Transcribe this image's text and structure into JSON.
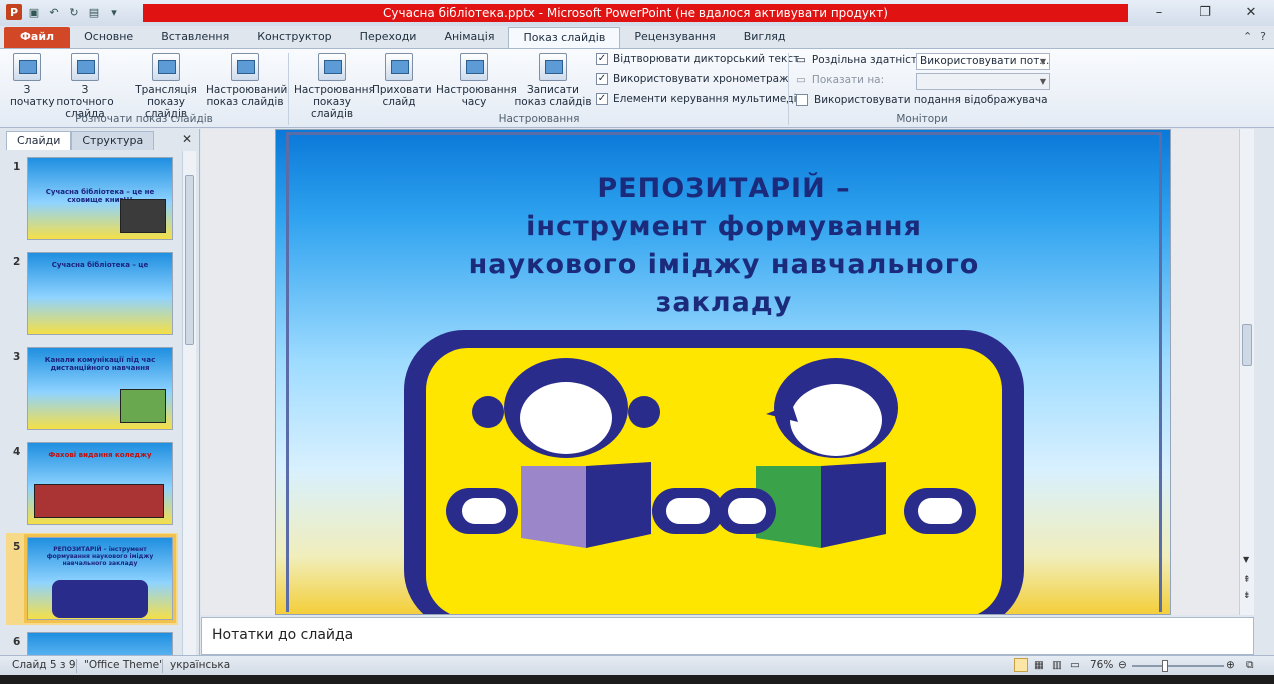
{
  "window": {
    "title": "Сучасна бібліотека.pptx - Microsoft PowerPoint (не вдалося активувати продукт)",
    "min": "–",
    "max": "❐",
    "close": "✕"
  },
  "tabs": [
    "Файл",
    "Основне",
    "Вставлення",
    "Конструктор",
    "Переходи",
    "Анімація",
    "Показ слайдів",
    "Рецензування",
    "Вигляд"
  ],
  "active_tab": "Показ слайдів",
  "ribbon": {
    "start_group": {
      "label": "Розпочати показ слайдів",
      "from_start": "З\nпочатку",
      "from_current": "З поточного\nслайда",
      "broadcast": "Трансляція\nпоказу слайдів",
      "custom": "Настроюваний\nпоказ слайдів"
    },
    "setup_group": {
      "label": "Настроювання",
      "setup": "Настроювання\nпоказу слайдів",
      "hide": "Приховати\nслайд",
      "rehearse": "Настроювання\nчасу",
      "record": "Записати\nпоказ слайдів",
      "checks": [
        {
          "label": "Відтворювати дикторський текст",
          "checked": true
        },
        {
          "label": "Використовувати хронометраж",
          "checked": true
        },
        {
          "label": "Елементи керування мультимедіа",
          "checked": true
        }
      ]
    },
    "monitors_group": {
      "label": "Монітори",
      "resolution_label": "Роздільна здатність:",
      "resolution_value": "Використовувати пот...",
      "show_on_label": "Показати на:",
      "show_on_value": "",
      "presenter_view_label": "Використовувати подання відображувача",
      "presenter_view_checked": false
    }
  },
  "left_pane": {
    "tab_slides": "Слайди",
    "tab_outline": "Структура",
    "close": "✕",
    "thumbs": [
      {
        "num": "1",
        "text": "Сучасна бібліотека – це не сховище книг!!!"
      },
      {
        "num": "2",
        "text": "Сучасна бібліотека – це"
      },
      {
        "num": "3",
        "text": "Канали комунікації під час дистанційного навчання"
      },
      {
        "num": "4",
        "text": "Фахові видання коледжу"
      },
      {
        "num": "5",
        "text": "РЕПОЗИТАРІЙ – інструмент формування наукового іміджу навчального закладу"
      },
      {
        "num": "6",
        "text": ""
      }
    ],
    "selected": 5
  },
  "slide": {
    "title_line1": "РЕПОЗИТАРІЙ –",
    "title_line2": "інструмент формування",
    "title_line3": "наукового іміджу навчального",
    "title_line4": "закладу"
  },
  "notes": {
    "placeholder": "Нотатки до слайда"
  },
  "status": {
    "slide": "Слайд 5 з 9",
    "theme": "\"Office Theme\"",
    "language": "українська",
    "zoom": "76%"
  },
  "colors": {
    "file_tab": "#d24726",
    "title_highlight": "#e01212",
    "slide_title": "#1b2a7a",
    "logo_border": "#2a2c8c",
    "logo_fill": "#ffe600"
  }
}
